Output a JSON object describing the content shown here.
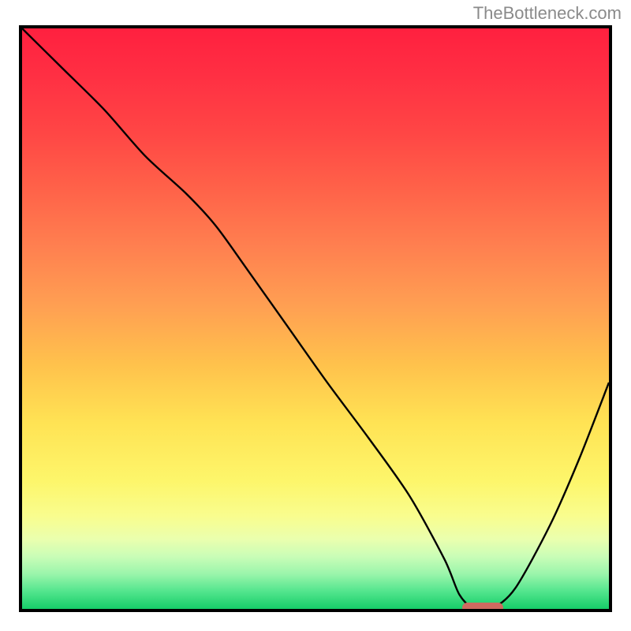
{
  "watermark": "TheBottleneck.com",
  "chart_data": {
    "type": "line",
    "title": "",
    "xlabel": "",
    "ylabel": "",
    "xlim": [
      0,
      1
    ],
    "ylim": [
      0,
      1
    ],
    "x": [
      0.0,
      0.07,
      0.14,
      0.21,
      0.28,
      0.33,
      0.38,
      0.45,
      0.52,
      0.59,
      0.66,
      0.72,
      0.745,
      0.77,
      0.8,
      0.84,
      0.9,
      0.95,
      1.0
    ],
    "y": [
      1.0,
      0.93,
      0.86,
      0.78,
      0.715,
      0.66,
      0.59,
      0.49,
      0.39,
      0.295,
      0.195,
      0.085,
      0.025,
      0.0,
      0.0,
      0.035,
      0.145,
      0.26,
      0.39
    ],
    "gradient_colors": [
      "#ff203f",
      "#ff8150",
      "#ffe354",
      "#16cd69"
    ],
    "marker": {
      "x_center": 0.785,
      "y": 0.0,
      "width": 0.07,
      "color": "#cf6a60",
      "shape": "rounded-rect"
    }
  },
  "layout": {
    "inner_w": 744,
    "inner_h": 736
  }
}
